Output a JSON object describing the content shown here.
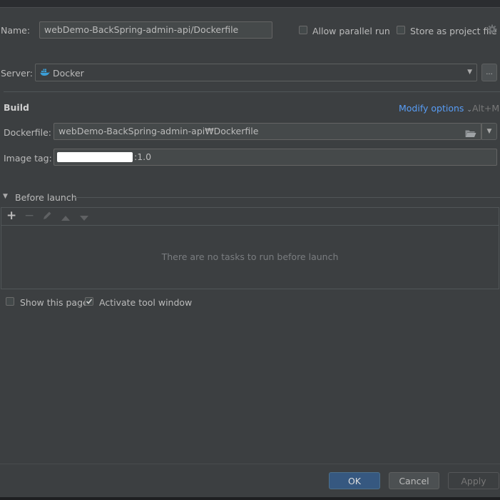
{
  "form": {
    "name_label": "Name:",
    "name_value": "webDemo-BackSpring-admin-api/Dockerfile",
    "allow_parallel_label": "Allow parallel run",
    "store_project_label": "Store as project file",
    "server_label": "Server:",
    "server_value": "Docker",
    "server_more_label": "..."
  },
  "build": {
    "section_title": "Build",
    "modify_options_label": "Modify options",
    "modify_options_shortcut": "Alt+M",
    "dockerfile_label": "Dockerfile:",
    "dockerfile_value": "webDemo-BackSpring-admin-api₩Dockerfile",
    "image_tag_label": "Image tag:",
    "image_tag_suffix": ":1.0"
  },
  "before_launch": {
    "title": "Before launch",
    "empty_text": "There are no tasks to run before launch",
    "add_glyph": "+",
    "remove_glyph": "−"
  },
  "options": {
    "show_page_label": "Show this page",
    "activate_tool_label": "Activate tool window",
    "show_page_checked": false,
    "activate_tool_checked": true
  },
  "footer": {
    "ok_label": "OK",
    "cancel_label": "Cancel",
    "apply_label": "Apply"
  },
  "colors": {
    "background": "#3c3f41",
    "link": "#589df6",
    "primary_button": "#365880",
    "docker_blue": "#3b9fd8"
  }
}
